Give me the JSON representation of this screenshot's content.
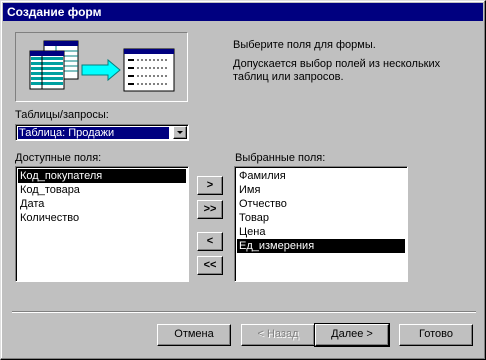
{
  "window": {
    "title": "Создание форм"
  },
  "info": {
    "line1": "Выберите поля для формы.",
    "line2": "Допускается выбор полей из нескольких таблиц или запросов."
  },
  "tables": {
    "label": "Таблицы/запросы:",
    "selected": "Таблица: Продажи"
  },
  "available": {
    "label": "Доступные поля:",
    "items": [
      "Код_покупателя",
      "Код_товара",
      "Дата",
      "Количество"
    ],
    "selected_index": 0
  },
  "selected_fields": {
    "label": "Выбранные поля:",
    "items": [
      "Фамилия",
      "Имя",
      "Отчество",
      "Товар",
      "Цена",
      "Ед_измерения"
    ],
    "selected_index": 5
  },
  "move_buttons": {
    "add_one": ">",
    "add_all": ">>",
    "remove_one": "<",
    "remove_all": "<<"
  },
  "footer": {
    "cancel": "Отмена",
    "back": "< Назад",
    "next": "Далее >",
    "finish": "Готово"
  },
  "icons": {
    "illustration": "table-to-form-illustration",
    "dropdown": "chevron-down-icon"
  }
}
